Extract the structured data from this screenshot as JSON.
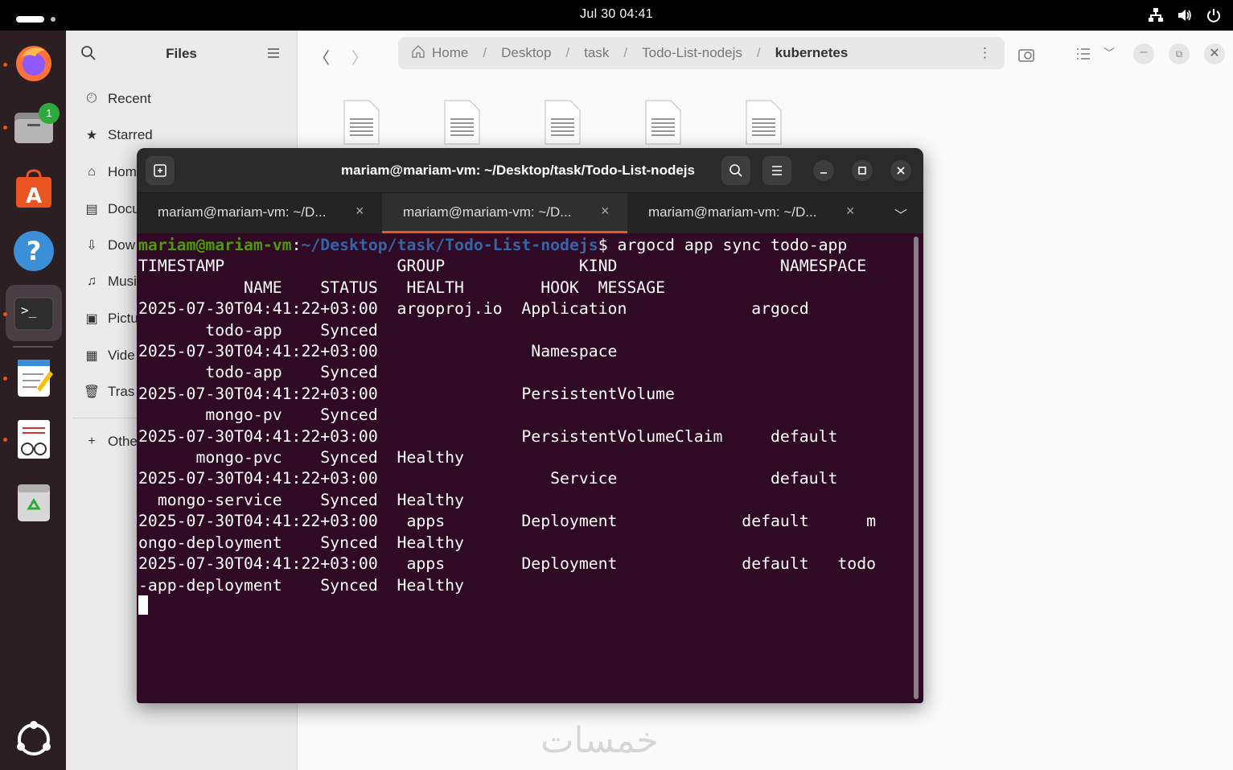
{
  "topbar": {
    "datetime": "Jul 30  04:41",
    "tray_icons": [
      "network-icon",
      "volume-icon",
      "power-icon"
    ]
  },
  "dock": {
    "items": [
      {
        "name": "firefox",
        "badge": ""
      },
      {
        "name": "files",
        "badge": "1"
      },
      {
        "name": "app-center",
        "badge": ""
      },
      {
        "name": "help",
        "badge": ""
      },
      {
        "name": "terminal",
        "badge": ""
      },
      {
        "name": "text-editor",
        "badge": ""
      },
      {
        "name": "document-viewer",
        "badge": ""
      },
      {
        "name": "trash",
        "badge": ""
      },
      {
        "name": "show-apps",
        "badge": ""
      }
    ]
  },
  "files": {
    "title": "Files",
    "sidebar": [
      {
        "label": "Recent",
        "icon": "clock-icon"
      },
      {
        "label": "Starred",
        "icon": "star-icon"
      },
      {
        "label": "Hom",
        "icon": "home-icon"
      },
      {
        "label": "Docu",
        "icon": "document-icon"
      },
      {
        "label": "Dow",
        "icon": "download-icon"
      },
      {
        "label": "Musi",
        "icon": "music-icon"
      },
      {
        "label": "Pictu",
        "icon": "picture-icon"
      },
      {
        "label": "Vide",
        "icon": "video-icon"
      },
      {
        "label": "Tras",
        "icon": "trash-icon"
      },
      {
        "label": "Othe",
        "icon": "plus-icon"
      }
    ],
    "path": [
      "Home",
      "Desktop",
      "task",
      "Todo-List-nodejs",
      "kubernetes"
    ]
  },
  "terminal": {
    "title": "mariam@mariam-vm: ~/Desktop/task/Todo-List-nodejs",
    "tabs": [
      {
        "label": "mariam@mariam-vm: ~/D...",
        "active": false
      },
      {
        "label": "mariam@mariam-vm: ~/D...",
        "active": true
      },
      {
        "label": "mariam@mariam-vm: ~/D...",
        "active": false
      }
    ],
    "prompt_user": "mariam@mariam-vm",
    "prompt_sep": ":",
    "prompt_path": "~/Desktop/task/Todo-List-nodejs",
    "prompt_cmd": "$ argocd app sync todo-app",
    "output": [
      "TIMESTAMP                  GROUP              KIND                 NAMESPACE",
      "           NAME    STATUS   HEALTH        HOOK  MESSAGE",
      "2025-07-30T04:41:22+03:00  argoproj.io  Application             argocd",
      "       todo-app    Synced",
      "2025-07-30T04:41:22+03:00                Namespace",
      "       todo-app    Synced",
      "2025-07-30T04:41:22+03:00               PersistentVolume",
      "       mongo-pv    Synced",
      "2025-07-30T04:41:22+03:00               PersistentVolumeClaim     default",
      "      mongo-pvc    Synced  Healthy",
      "2025-07-30T04:41:22+03:00                  Service                default",
      "  mongo-service    Synced  Healthy",
      "2025-07-30T04:41:22+03:00   apps        Deployment             default      m",
      "ongo-deployment    Synced  Healthy",
      "2025-07-30T04:41:22+03:00   apps        Deployment             default   todo",
      "-app-deployment    Synced  Healthy"
    ]
  },
  "watermark": "خمسات",
  "colors": {
    "terminal_bg": "#300a24",
    "prompt_user": "#4e9a06",
    "prompt_path": "#3465a4",
    "accent": "#e95420"
  }
}
